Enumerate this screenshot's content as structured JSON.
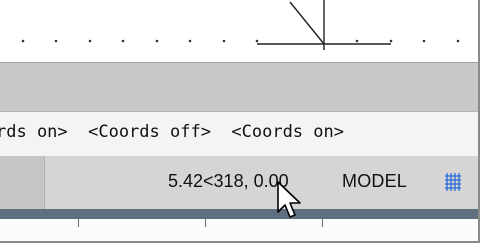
{
  "command_line": {
    "text": "rds on>  <Coords off>  <Coords on>"
  },
  "status_bar": {
    "coordinates": "5.42<318, 0.00",
    "model_label": "MODEL",
    "grid_icon": "grid-icon"
  },
  "cursor_icon": "arrow-cursor-icon",
  "colors": {
    "status_bg": "#d5d5d5",
    "command_bg": "#f4f4f4",
    "panel_gray": "#c9c9c9",
    "grid_blue": "#2c6bd8"
  }
}
